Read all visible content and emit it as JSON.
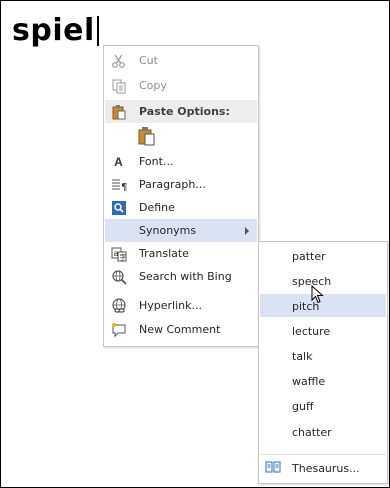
{
  "document": {
    "word": "spiel"
  },
  "context_menu": {
    "items": [
      {
        "id": "cut",
        "label": "Cut",
        "icon": "scissors-icon",
        "disabled": true
      },
      {
        "id": "copy",
        "label": "Copy",
        "icon": "copy-icon",
        "disabled": true
      },
      {
        "id": "paste-options",
        "label": "Paste Options:",
        "icon": "clipboard-icon",
        "header": true
      },
      {
        "id": "font",
        "label": "Font...",
        "icon": "font-a-icon"
      },
      {
        "id": "paragraph",
        "label": "Paragraph...",
        "icon": "paragraph-icon"
      },
      {
        "id": "define",
        "label": "Define",
        "icon": "define-icon"
      },
      {
        "id": "synonyms",
        "label": "Synonyms",
        "icon": "",
        "submenu": true,
        "highlighted": true
      },
      {
        "id": "translate",
        "label": "Translate",
        "icon": "translate-icon"
      },
      {
        "id": "search-bing",
        "label": "Search with Bing",
        "icon": "search-globe-icon"
      },
      {
        "id": "hyperlink",
        "label": "Hyperlink...",
        "icon": "hyperlink-globe-icon"
      },
      {
        "id": "new-comment",
        "label": "New Comment",
        "icon": "new-comment-icon"
      }
    ],
    "paste_option_icon": "paste-keep-text-icon"
  },
  "synonyms_submenu": {
    "items": [
      {
        "label": "patter"
      },
      {
        "label": "speech"
      },
      {
        "label": "pitch",
        "highlighted": true
      },
      {
        "label": "lecture"
      },
      {
        "label": "talk"
      },
      {
        "label": "waffle"
      },
      {
        "label": "guff"
      },
      {
        "label": "chatter"
      }
    ],
    "thesaurus": {
      "label": "Thesaurus...",
      "icon": "thesaurus-book-icon"
    }
  },
  "colors": {
    "highlight": "#dbe3f2",
    "header_bg": "#ececec",
    "menu_border": "#c6c6c6",
    "disabled_text": "#8f8f8f"
  }
}
